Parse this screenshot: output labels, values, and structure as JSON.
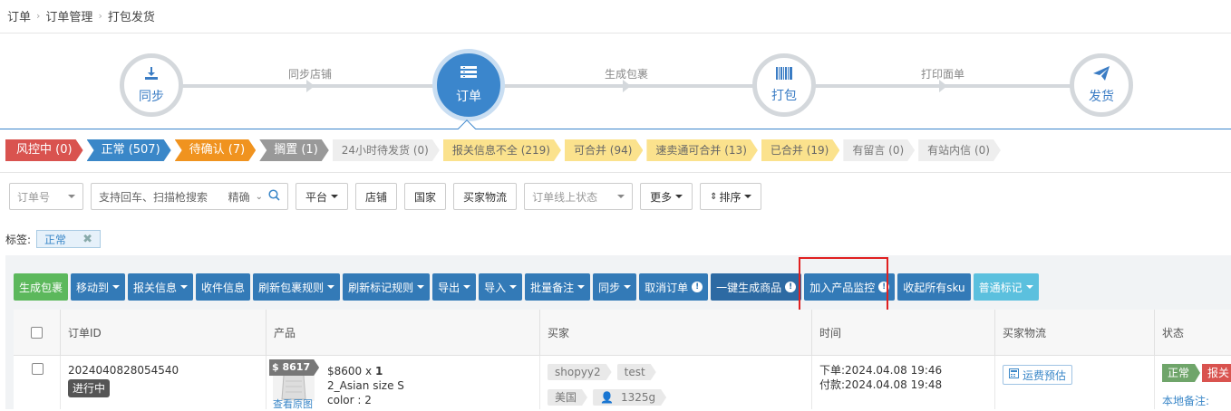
{
  "breadcrumb": [
    "订单",
    "订单管理",
    "打包发货"
  ],
  "steps": [
    {
      "label": "同步",
      "icon": "download-icon"
    },
    {
      "label": "订单",
      "icon": "list-icon"
    },
    {
      "label": "打包",
      "icon": "barcode-icon"
    },
    {
      "label": "发货",
      "icon": "send-icon"
    }
  ],
  "step_links": [
    "同步店铺",
    "生成包裹",
    "打印面单"
  ],
  "status_tabs": [
    {
      "label": "风控中 (0)",
      "style": "red"
    },
    {
      "label": "正常 (507)",
      "style": "blue"
    },
    {
      "label": "待确认 (7)",
      "style": "orange"
    },
    {
      "label": "搁置 (1)",
      "style": "gray"
    },
    {
      "label": "24小时待发货 (0)",
      "style": "light"
    },
    {
      "label": "报关信息不全 (219)",
      "style": "yellow"
    },
    {
      "label": "可合并 (94)",
      "style": "yellow"
    },
    {
      "label": "速卖通可合并 (13)",
      "style": "yellow"
    },
    {
      "label": "已合并 (19)",
      "style": "yellow"
    },
    {
      "label": "有留言 (0)",
      "style": "light"
    },
    {
      "label": "有站内信 (0)",
      "style": "light"
    }
  ],
  "filters": {
    "order_no": "订单号",
    "search_placeholder": "支持回车、扫描枪搜索",
    "match": "精确",
    "platform": "平台",
    "shop": "店铺",
    "country": "国家",
    "buyer_logistics": "买家物流",
    "online_status": "订单线上状态",
    "more": "更多",
    "sort": "排序"
  },
  "label_filter": {
    "title": "标签:",
    "chip": "正常"
  },
  "actions": [
    {
      "label": "生成包裹",
      "style": "green",
      "caret": false,
      "warn": false
    },
    {
      "label": "移动到",
      "style": "blue",
      "caret": true,
      "warn": false
    },
    {
      "label": "报关信息",
      "style": "blue",
      "caret": true,
      "warn": false
    },
    {
      "label": "收件信息",
      "style": "blue",
      "caret": false,
      "warn": false
    },
    {
      "label": "刷新包裹规则",
      "style": "blue",
      "caret": true,
      "warn": false
    },
    {
      "label": "刷新标记规则",
      "style": "blue",
      "caret": true,
      "warn": false
    },
    {
      "label": "导出",
      "style": "blue",
      "caret": true,
      "warn": false
    },
    {
      "label": "导入",
      "style": "blue",
      "caret": true,
      "warn": false
    },
    {
      "label": "批量备注",
      "style": "blue",
      "caret": true,
      "warn": false
    },
    {
      "label": "同步",
      "style": "blue",
      "caret": true,
      "warn": false
    },
    {
      "label": "取消订单",
      "style": "blue",
      "caret": false,
      "warn": true
    },
    {
      "label": "一键生成商品",
      "style": "dark",
      "caret": false,
      "warn": true
    },
    {
      "label": "加入产品监控",
      "style": "blue",
      "caret": false,
      "warn": true
    },
    {
      "label": "收起所有sku",
      "style": "blue",
      "caret": false,
      "warn": false
    },
    {
      "label": "普通标记",
      "style": "cyan",
      "caret": true,
      "warn": false
    }
  ],
  "table": {
    "headers": [
      "订单ID",
      "产品",
      "买家",
      "时间",
      "买家物流",
      "状态"
    ],
    "row": {
      "order_id": "2024040828054540",
      "progress": "进行中",
      "price_badge": "$ 8617",
      "price": "$8600",
      "qty_x": "x",
      "qty": "1",
      "sku": "2_Asian size S",
      "color": "color : 2",
      "view_img": "查看原图",
      "buyer_tags": [
        "shopyy2",
        "test"
      ],
      "buyer_country": "美国",
      "buyer_weight": "1325g",
      "order_time": "下单:2024.04.08 19:46",
      "pay_time": "付款:2024.04.08 19:48",
      "logistics_btn": "运费预估",
      "status_tag": "正常",
      "status_tag2": "报关",
      "remark": "本地备注:"
    }
  },
  "colors": {
    "primary": "#337ab7",
    "active_step": "#3b86cc",
    "green": "#5cb85c",
    "highlight_box": "#e02020"
  }
}
